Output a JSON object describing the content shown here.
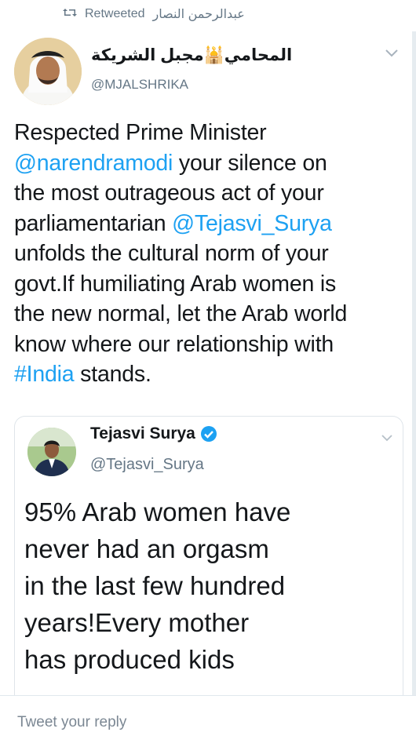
{
  "retweet": {
    "label": "Retweeted",
    "by": "عبدالرحمن النصار"
  },
  "tweet": {
    "name": "المحامي🕌مجبل الشريكة",
    "handle": "@MJALSHRIKA",
    "parts": [
      "Respected Prime Minister\n",
      "@narendramodi",
      " your silence on\nthe most outrageous act of your\nparliamentarian ",
      "@Tejasvi_Surya",
      "\nunfolds the cultural norm of your\ngovt.If humiliating Arab women is\nthe new normal, let the Arab world\nknow where our relationship with\n",
      "#India",
      " stands."
    ]
  },
  "quote": {
    "name": "Tejasvi Surya",
    "handle": "@Tejasvi_Surya",
    "text": "95% Arab women have\nnever had an orgasm\nin the last few hundred\nyears!Every mother\nhas produced kids"
  },
  "reply": {
    "placeholder": "Tweet your reply"
  },
  "colors": {
    "accent": "#1da1f2",
    "muted": "#657786",
    "text": "#14171a"
  }
}
